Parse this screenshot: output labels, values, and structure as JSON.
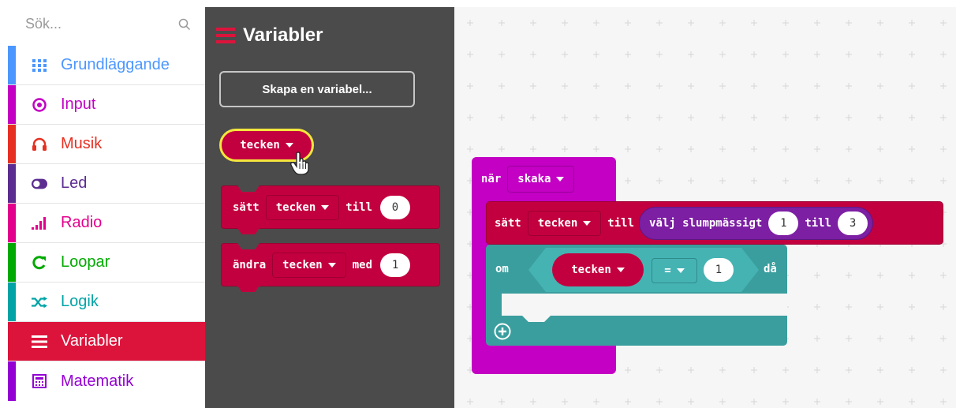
{
  "search": {
    "placeholder": "Sök..."
  },
  "categories": [
    {
      "label": "Grundläggande",
      "color": "#4c97ff",
      "icon": "grid-icon"
    },
    {
      "label": "Input",
      "color": "#c300c3",
      "icon": "circle-target-icon"
    },
    {
      "label": "Musik",
      "color": "#e63022",
      "icon": "headphones-icon"
    },
    {
      "label": "Led",
      "color": "#5c2d91",
      "icon": "toggle-icon"
    },
    {
      "label": "Radio",
      "color": "#e3008c",
      "icon": "signal-bars-icon"
    },
    {
      "label": "Loopar",
      "color": "#00aa00",
      "icon": "refresh-icon"
    },
    {
      "label": "Logik",
      "color": "#00a4a6",
      "icon": "shuffle-icon"
    },
    {
      "label": "Variabler",
      "color": "#dc143c",
      "icon": "list-lines-icon",
      "selected": true
    },
    {
      "label": "Matematik",
      "color": "#9400d3",
      "icon": "calculator-icon"
    }
  ],
  "flyout": {
    "title": "Variabler",
    "create_button": "Skapa en variabel...",
    "variable_name": "tecken",
    "set_block": {
      "verb": "sätt",
      "variable": "tecken",
      "to": "till",
      "value": "0"
    },
    "change_block": {
      "verb": "ändra",
      "variable": "tecken",
      "by": "med",
      "value": "1"
    }
  },
  "workspace": {
    "event": {
      "label": "när",
      "gesture": "skaka"
    },
    "set": {
      "verb": "sätt",
      "variable": "tecken",
      "to": "till",
      "random_label": "välj slumpmässigt",
      "from": "1",
      "range_to": "till",
      "to_value": "3"
    },
    "if": {
      "label": "om",
      "variable": "tecken",
      "operator": "=",
      "value": "1",
      "then": "då"
    }
  },
  "colors": {
    "variables": "#c3003f",
    "input": "#c300c3",
    "logic": "#3b9e9e",
    "math": "#7c1fa3",
    "flyout_bg": "#4b4b4b"
  }
}
